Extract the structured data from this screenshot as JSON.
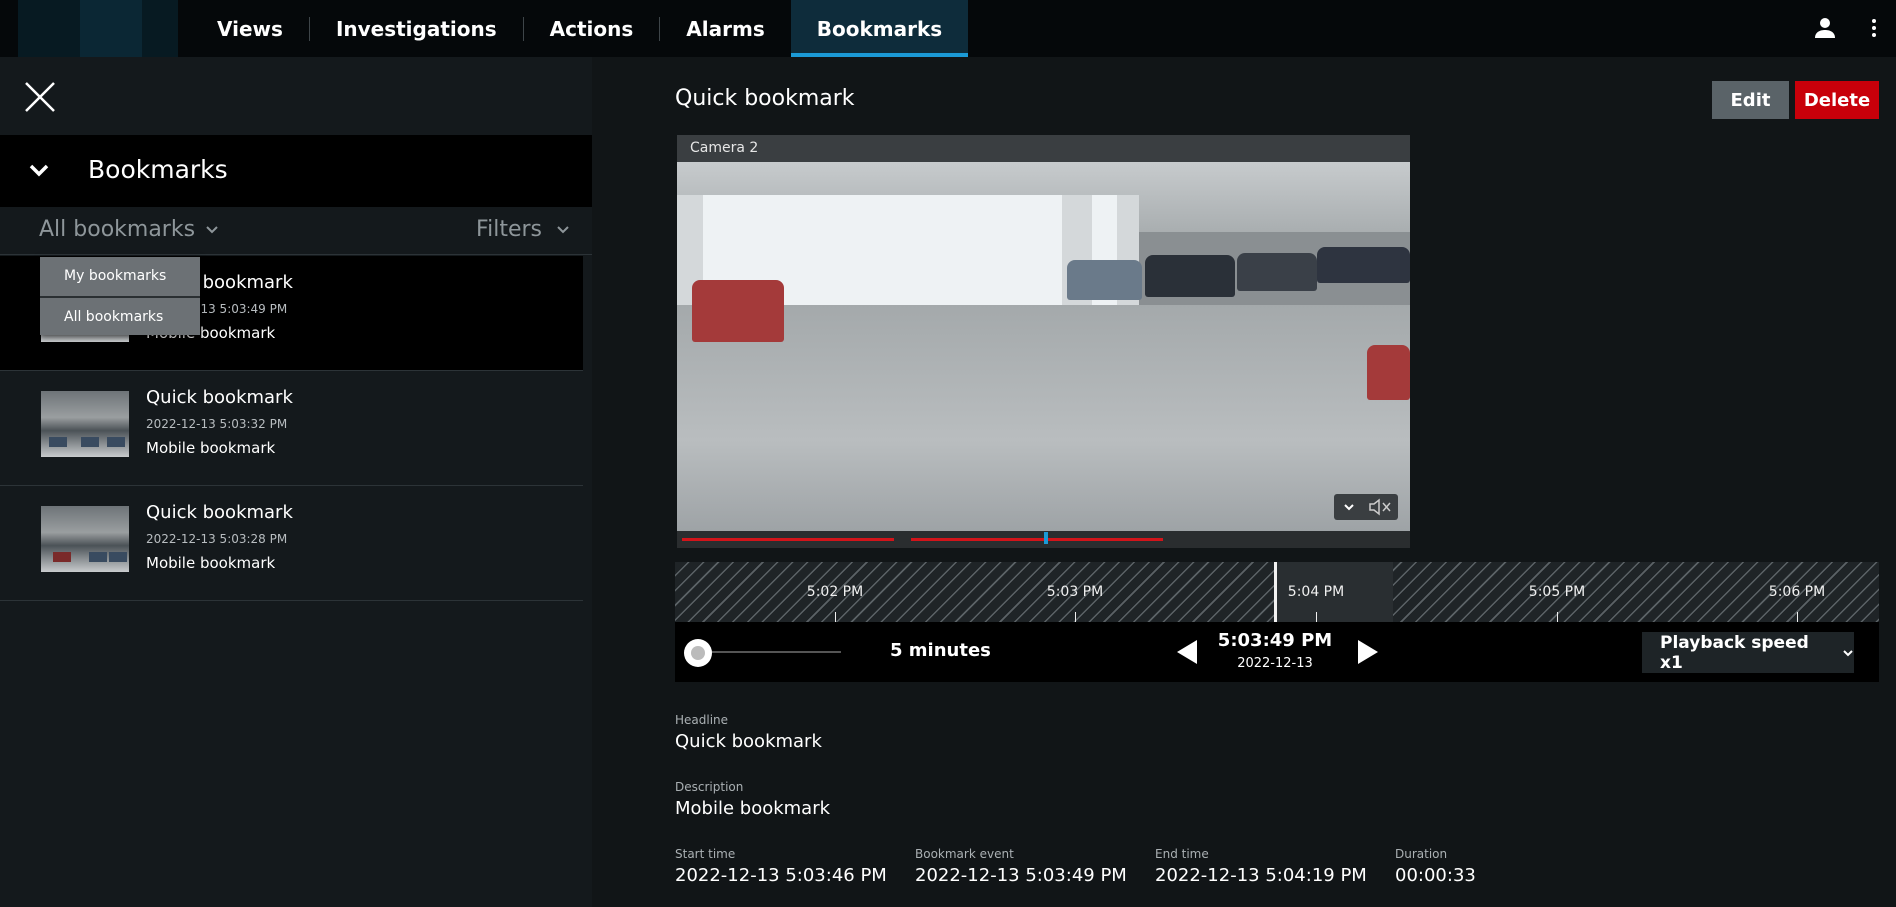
{
  "nav": {
    "items": [
      {
        "label": "Views"
      },
      {
        "label": "Investigations"
      },
      {
        "label": "Actions"
      },
      {
        "label": "Alarms"
      },
      {
        "label": "Bookmarks"
      }
    ],
    "active_index": 4
  },
  "panel": {
    "title": "Bookmarks",
    "scope_label": "All bookmarks",
    "filters_label": "Filters",
    "dropdown_options": [
      "My bookmarks",
      "All bookmarks"
    ],
    "bookmarks": [
      {
        "title": "Quick bookmark",
        "time": "2022-12-13 5:03:49 PM",
        "description": "Mobile bookmark",
        "selected": true
      },
      {
        "title": "Quick bookmark",
        "time": "2022-12-13 5:03:32 PM",
        "description": "Mobile bookmark",
        "selected": false
      },
      {
        "title": "Quick bookmark",
        "time": "2022-12-13 5:03:28 PM",
        "description": "Mobile bookmark",
        "selected": false
      }
    ]
  },
  "detail": {
    "title": "Quick bookmark",
    "edit_label": "Edit",
    "delete_label": "Delete",
    "camera_label": "Camera 2",
    "timeline_ticks": [
      "5:02 PM",
      "5:03 PM",
      "5:04 PM",
      "5:05 PM",
      "5:06 PM"
    ],
    "span_label": "5 minutes",
    "current_time": "5:03:49 PM",
    "current_date": "2022-12-13",
    "playback_speed": "Playback speed x1",
    "fields": {
      "headline_label": "Headline",
      "headline": "Quick bookmark",
      "description_label": "Description",
      "description": "Mobile bookmark",
      "start_label": "Start time",
      "start": "2022-12-13 5:03:46 PM",
      "event_label": "Bookmark event",
      "event": "2022-12-13 5:03:49 PM",
      "end_label": "End time",
      "end": "2022-12-13 5:04:19 PM",
      "duration_label": "Duration",
      "duration": "00:00:33"
    }
  },
  "colors": {
    "accent": "#1b9ad6",
    "delete": "#c8000a",
    "edit": "#5a6368",
    "recording": "#d2141a"
  }
}
